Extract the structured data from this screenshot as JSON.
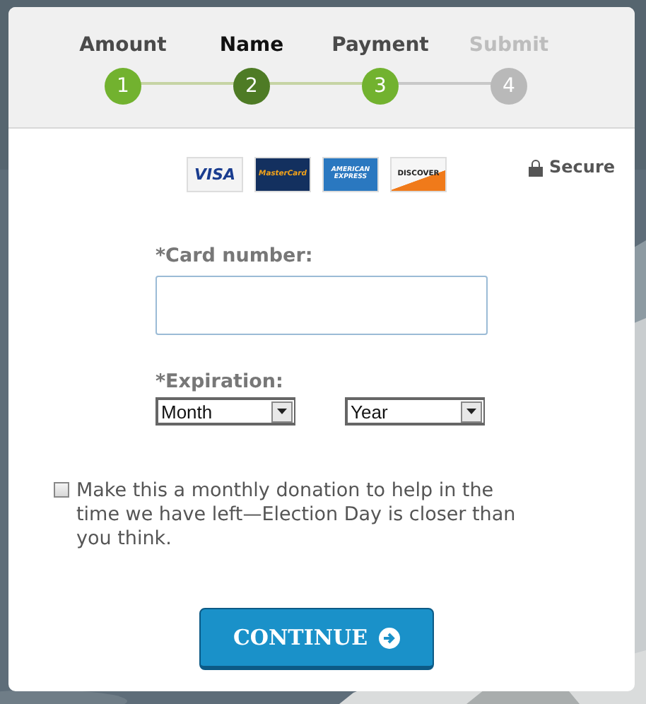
{
  "steps": [
    {
      "label": "Amount",
      "number": "1",
      "selected": false,
      "completed": true
    },
    {
      "label": "Name",
      "number": "2",
      "selected": true,
      "completed": false
    },
    {
      "label": "Payment",
      "number": "3",
      "selected": false,
      "completed": true
    },
    {
      "label": "Submit",
      "number": "4",
      "selected": false,
      "completed": false
    }
  ],
  "cards": [
    {
      "kind": "visa",
      "label": "VISA"
    },
    {
      "kind": "mastercard",
      "label": "MasterCard"
    },
    {
      "kind": "amex",
      "label": "AMERICAN EXPRESS"
    },
    {
      "kind": "discover",
      "label": "DISCOVER"
    }
  ],
  "secure": "Secure",
  "card_number": {
    "label": "*Card number:"
  },
  "expiration": {
    "label": "*Expiration:",
    "month": "Month",
    "year": "Year"
  },
  "monthly": {
    "checked": false,
    "text": "Make this a monthly donation to help in the time we have left—Election Day is closer than you think."
  },
  "continue_button": "CONTINUE"
}
